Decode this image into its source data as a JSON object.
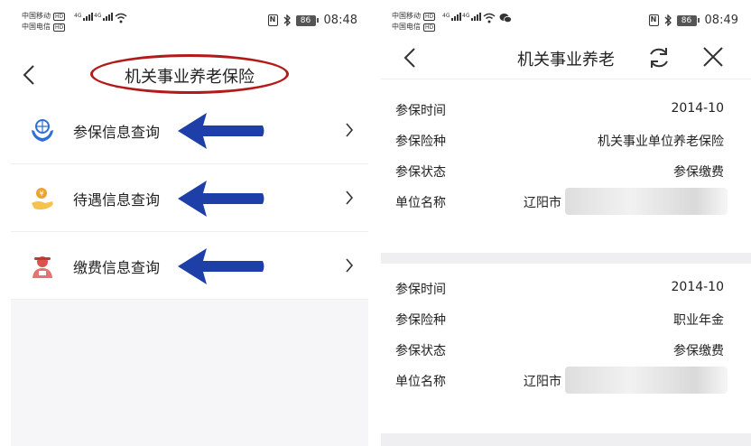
{
  "left_screen": {
    "status": {
      "carrier1": "中国移动",
      "carrier2": "中国电信",
      "hd": "HD",
      "net_tag": "4G",
      "nfc": "N",
      "battery": "86",
      "time": "08:48"
    },
    "header": {
      "title": "机关事业养老保险"
    },
    "menu": [
      {
        "label": "参保信息查询",
        "icon": "hands-globe-icon"
      },
      {
        "label": "待遇信息查询",
        "icon": "hand-coin-icon"
      },
      {
        "label": "缴费信息查询",
        "icon": "person-payment-icon"
      }
    ]
  },
  "right_screen": {
    "status": {
      "carrier1": "中国移动",
      "carrier2": "中国电信",
      "hd": "HD",
      "net_tag": "4G",
      "nfc": "N",
      "battery": "86",
      "time": "08:49"
    },
    "header": {
      "title": "机关事业养老"
    },
    "records": [
      {
        "rows": [
          {
            "key": "参保时间",
            "value": "2014-10"
          },
          {
            "key": "参保险种",
            "value": "机关事业单位养老保险"
          },
          {
            "key": "参保状态",
            "value": "参保缴费"
          },
          {
            "key": "单位名称",
            "value": "辽阳市"
          }
        ]
      },
      {
        "rows": [
          {
            "key": "参保时间",
            "value": "2014-10"
          },
          {
            "key": "参保险种",
            "value": "职业年金"
          },
          {
            "key": "参保状态",
            "value": "参保缴费"
          },
          {
            "key": "单位名称",
            "value": "辽阳市"
          }
        ]
      }
    ]
  },
  "colors": {
    "annotation_oval": "#b31b1b",
    "annotation_arrow": "#1f3fa8",
    "icon_blue": "#2f6fd6",
    "icon_gold": "#e8a62a",
    "icon_red": "#d9534f"
  }
}
